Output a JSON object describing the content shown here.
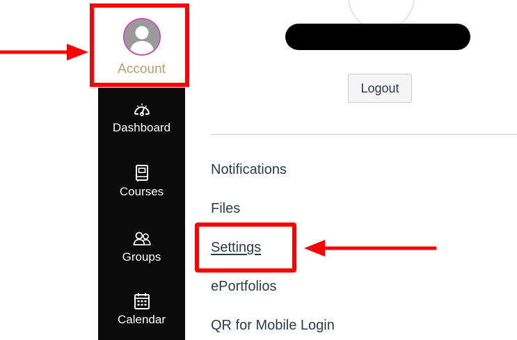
{
  "global_nav": {
    "account": {
      "label": "Account",
      "icon": "user-avatar-icon"
    },
    "items": [
      {
        "label": "Dashboard",
        "icon": "dashboard-icon"
      },
      {
        "label": "Courses",
        "icon": "courses-icon"
      },
      {
        "label": "Groups",
        "icon": "groups-icon"
      },
      {
        "label": "Calendar",
        "icon": "calendar-icon"
      }
    ]
  },
  "profile_tray": {
    "logout_label": "Logout",
    "links": [
      {
        "label": "Notifications"
      },
      {
        "label": "Files"
      },
      {
        "label": "Settings"
      },
      {
        "label": "ePortfolios"
      },
      {
        "label": "QR for Mobile Login"
      }
    ]
  },
  "annotations": {
    "highlight_color": "#ff0000"
  },
  "colors": {
    "nav_background": "#0b0b0b",
    "account_label": "#b89b6a",
    "avatar_border": "#c54bb5",
    "link_text": "#2d3b45"
  }
}
